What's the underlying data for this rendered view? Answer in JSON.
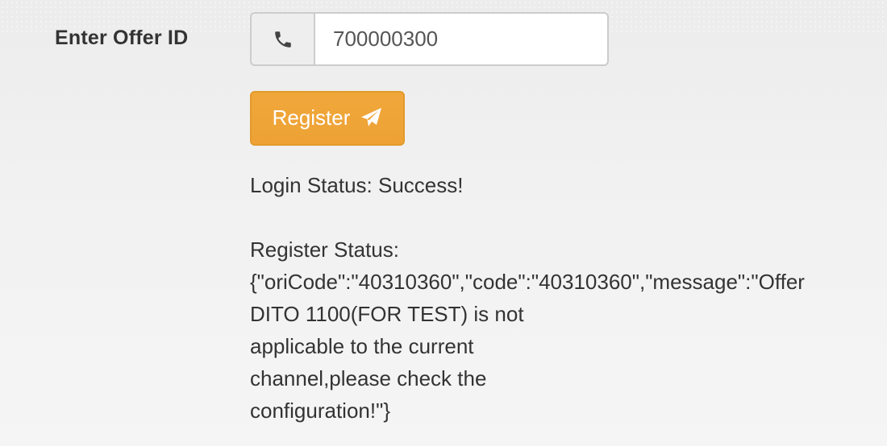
{
  "form": {
    "offer_label": "Enter Offer ID",
    "offer_value": "700000300",
    "phone_icon": "phone-icon",
    "register_label": "Register",
    "register_icon": "paper-plane-icon",
    "accent_color": "#f0ad4e"
  },
  "status": {
    "login": "Login Status: Success!",
    "register": "Register Status:\n{\"oriCode\":\"40310360\",\"code\":\"40310360\",\"message\":\"Offer\nDITO 1100(FOR TEST) is not\napplicable to the current\nchannel,please check the\nconfiguration!\"}"
  }
}
